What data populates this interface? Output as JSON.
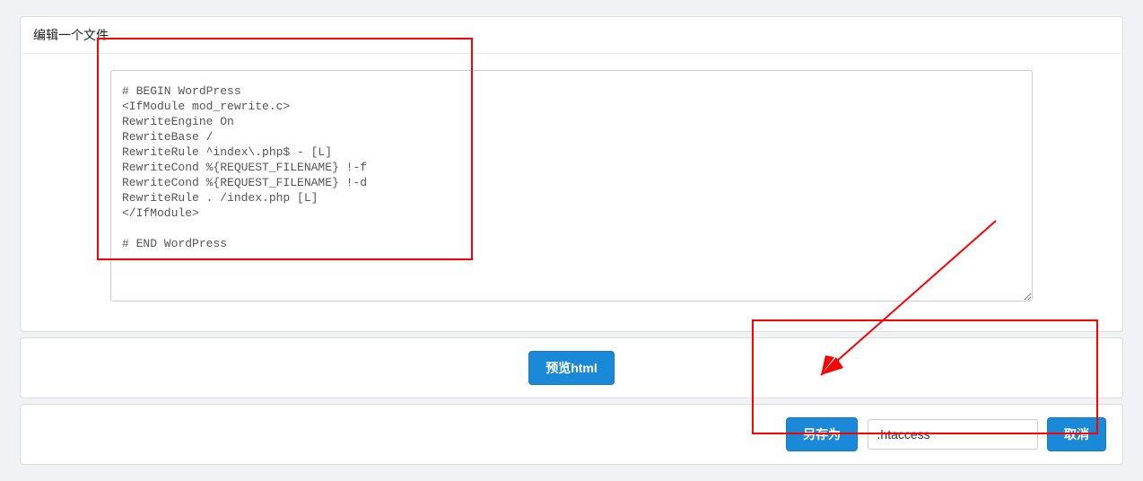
{
  "panel": {
    "title": "编辑一个文件"
  },
  "editor": {
    "content": "# BEGIN WordPress\n<IfModule mod_rewrite.c>\nRewriteEngine On\nRewriteBase /\nRewriteRule ^index\\.php$ - [L]\nRewriteCond %{REQUEST_FILENAME} !-f\nRewriteCond %{REQUEST_FILENAME} !-d\nRewriteRule . /index.php [L]\n</IfModule>\n\n# END WordPress"
  },
  "actions": {
    "preview_label": "预览html",
    "save_as_label": "另存为",
    "filename_value": ".htaccess",
    "cancel_label": "取消"
  }
}
